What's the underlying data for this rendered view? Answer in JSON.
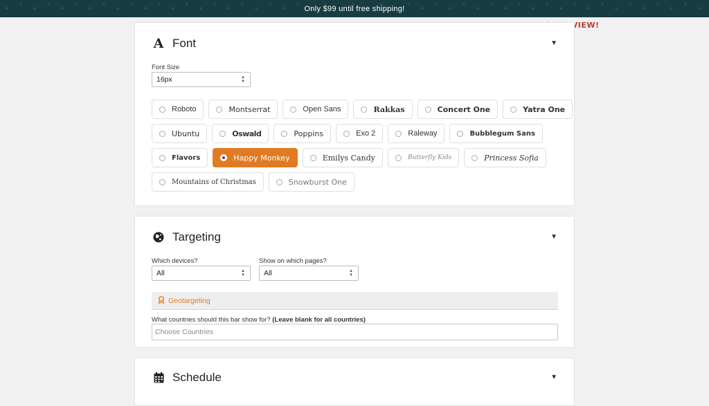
{
  "promo": {
    "text": "Only $99 until free shipping!"
  },
  "preview": {
    "label": "PREVIEW!"
  },
  "font_section": {
    "title": "Font",
    "font_size_label": "Font Size",
    "font_size_value": "16px",
    "rows": [
      [
        {
          "label": "Roboto"
        },
        {
          "label": "Montserrat"
        },
        {
          "label": "Open Sans"
        },
        {
          "label": "Rakkas"
        },
        {
          "label": "Concert One"
        },
        {
          "label": "Yatra One"
        }
      ],
      [
        {
          "label": "Ubuntu"
        },
        {
          "label": "Oswald"
        },
        {
          "label": "Poppins"
        },
        {
          "label": "Exo 2"
        },
        {
          "label": "Raleway"
        },
        {
          "label": "Bubblegum Sans"
        }
      ],
      [
        {
          "label": "Flavors"
        },
        {
          "label": "Happy Monkey",
          "selected": true
        },
        {
          "label": "Emilys Candy"
        },
        {
          "label": "Butterfly Kids"
        },
        {
          "label": "Princess Sofia"
        }
      ],
      [
        {
          "label": "Mountains of Christmas"
        },
        {
          "label": "Snowburst One"
        }
      ]
    ]
  },
  "targeting": {
    "title": "Targeting",
    "devices_label": "Which devices?",
    "devices_value": "All",
    "pages_label": "Show on which pages?",
    "pages_value": "All",
    "geo_label": "Geotargeting",
    "countries_question": "What countries should this bar show for?",
    "countries_hint": "(Leave blank for all countries)",
    "countries_placeholder": "Choose Countries"
  },
  "schedule": {
    "title": "Schedule"
  },
  "icons": {
    "font": "font-icon",
    "globe": "globe-icon",
    "calendar": "calendar-icon",
    "caret": "caret-down-icon",
    "geo": "award-icon"
  },
  "colors": {
    "accent": "#e07b24",
    "topbar": "#173c42",
    "preview": "#c0392b"
  }
}
